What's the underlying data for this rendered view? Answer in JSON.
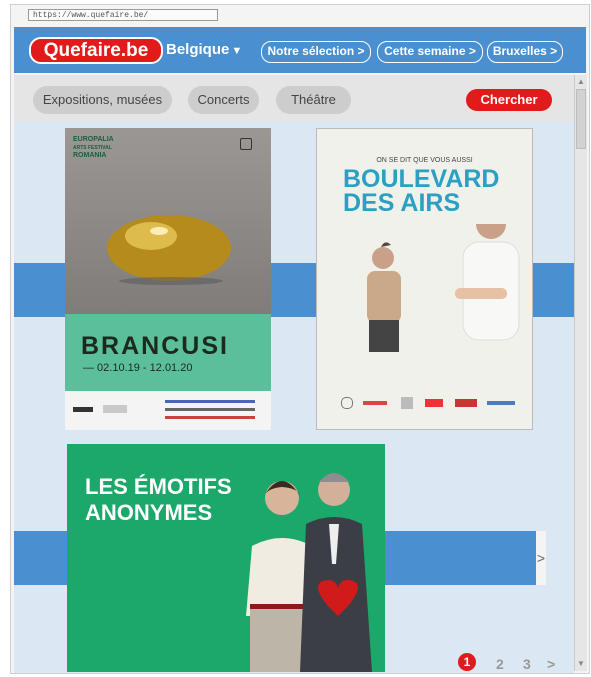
{
  "browser": {
    "url": "https://www.quefaire.be/"
  },
  "header": {
    "logo": "Quefaire.be",
    "region": "Belgique",
    "nav": [
      "Notre sélection >",
      "Cette semaine >",
      "Bruxelles >"
    ]
  },
  "categories": [
    "Expositions, musées",
    "Concerts",
    "Théâtre"
  ],
  "search_label": "Chercher",
  "posters": {
    "brancusi": {
      "header": [
        "EUROPALIA",
        "ARTS FESTIVAL",
        "ROMANIA"
      ],
      "title": "BRANCUSI",
      "dates": "— 02.10.19 - 12.01.20"
    },
    "boulevard": {
      "tagline": "ON SE DIT QUE VOUS AUSSI",
      "title": [
        "BOULEVARD",
        "DES AIRS"
      ]
    },
    "emotifs": {
      "title": [
        "LES ÉMOTIFS",
        "ANONYMES"
      ]
    }
  },
  "carousel_next": ">",
  "pagination": [
    "1",
    "2",
    "3",
    ">"
  ],
  "colors": {
    "brand_red": "#e11b1b",
    "header_blue": "#4a90d0",
    "band_blue": "#4a90d0",
    "poster_green": "#1ba86a",
    "brancusi_teal": "#5cbf9c"
  }
}
